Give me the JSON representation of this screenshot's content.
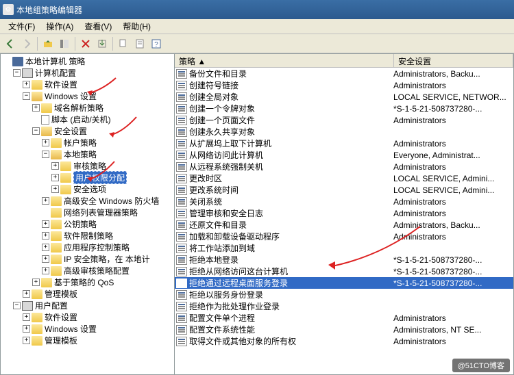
{
  "window": {
    "title": "本地组策略编辑器"
  },
  "menu": {
    "file": "文件(F)",
    "action": "操作(A)",
    "view": "查看(V)",
    "help": "帮助(H)"
  },
  "tree": {
    "root": "本地计算机 策略",
    "computer_config": "计算机配置",
    "software_settings": "软件设置",
    "windows_settings": "Windows 设置",
    "dns_policy": "域名解析策略",
    "scripts": "脚本 (启动/关机)",
    "security_settings": "安全设置",
    "account_policy": "帐户策略",
    "local_policy": "本地策略",
    "audit_policy": "审核策略",
    "user_rights": "用户权限分配",
    "security_options": "安全选项",
    "win_firewall": "高级安全 Windows 防火墙",
    "network_list": "网络列表管理器策略",
    "public_key": "公钥策略",
    "software_restrict": "软件限制策略",
    "app_control": "应用程序控制策略",
    "ip_security": "IP 安全策略，在 本地计",
    "advanced_audit": "高级审核策略配置",
    "policy_qos": "基于策略的 QoS",
    "admin_templates": "管理模板",
    "user_config": "用户配置",
    "u_software": "软件设置",
    "u_windows": "Windows 设置",
    "u_templates": "管理模板"
  },
  "list": {
    "header_policy": "策略 ",
    "header_security": "安全设置",
    "rows": [
      {
        "p": "备份文件和目录",
        "s": "Administrators, Backu..."
      },
      {
        "p": "创建符号链接",
        "s": "Administrators"
      },
      {
        "p": "创建全局对象",
        "s": "LOCAL SERVICE, NETWOR..."
      },
      {
        "p": "创建一个令牌对象",
        "s": "*S-1-5-21-508737280-..."
      },
      {
        "p": "创建一个页面文件",
        "s": "Administrators"
      },
      {
        "p": "创建永久共享对象",
        "s": ""
      },
      {
        "p": "从扩展坞上取下计算机",
        "s": "Administrators"
      },
      {
        "p": "从网络访问此计算机",
        "s": "Everyone, Administrat..."
      },
      {
        "p": "从远程系统强制关机",
        "s": "Administrators"
      },
      {
        "p": "更改时区",
        "s": "LOCAL SERVICE, Admini..."
      },
      {
        "p": "更改系统时间",
        "s": "LOCAL SERVICE, Admini..."
      },
      {
        "p": "关闭系统",
        "s": "Administrators"
      },
      {
        "p": "管理审核和安全日志",
        "s": "Administrators"
      },
      {
        "p": "还原文件和目录",
        "s": "Administrators, Backu..."
      },
      {
        "p": "加载和卸载设备驱动程序",
        "s": "Administrators"
      },
      {
        "p": "将工作站添加到域",
        "s": ""
      },
      {
        "p": "拒绝本地登录",
        "s": "*S-1-5-21-508737280-..."
      },
      {
        "p": "拒绝从网络访问这台计算机",
        "s": "*S-1-5-21-508737280-..."
      },
      {
        "p": "拒绝通过远程桌面服务登录",
        "s": "*S-1-5-21-508737280-...",
        "sel": true
      },
      {
        "p": "拒绝以服务身份登录",
        "s": ""
      },
      {
        "p": "拒绝作为批处理作业登录",
        "s": ""
      },
      {
        "p": "配置文件单个进程",
        "s": "Administrators"
      },
      {
        "p": "配置文件系统性能",
        "s": "Administrators, NT SE..."
      },
      {
        "p": "取得文件或其他对象的所有权",
        "s": "Administrators"
      }
    ]
  },
  "watermark": "@51CTO博客"
}
